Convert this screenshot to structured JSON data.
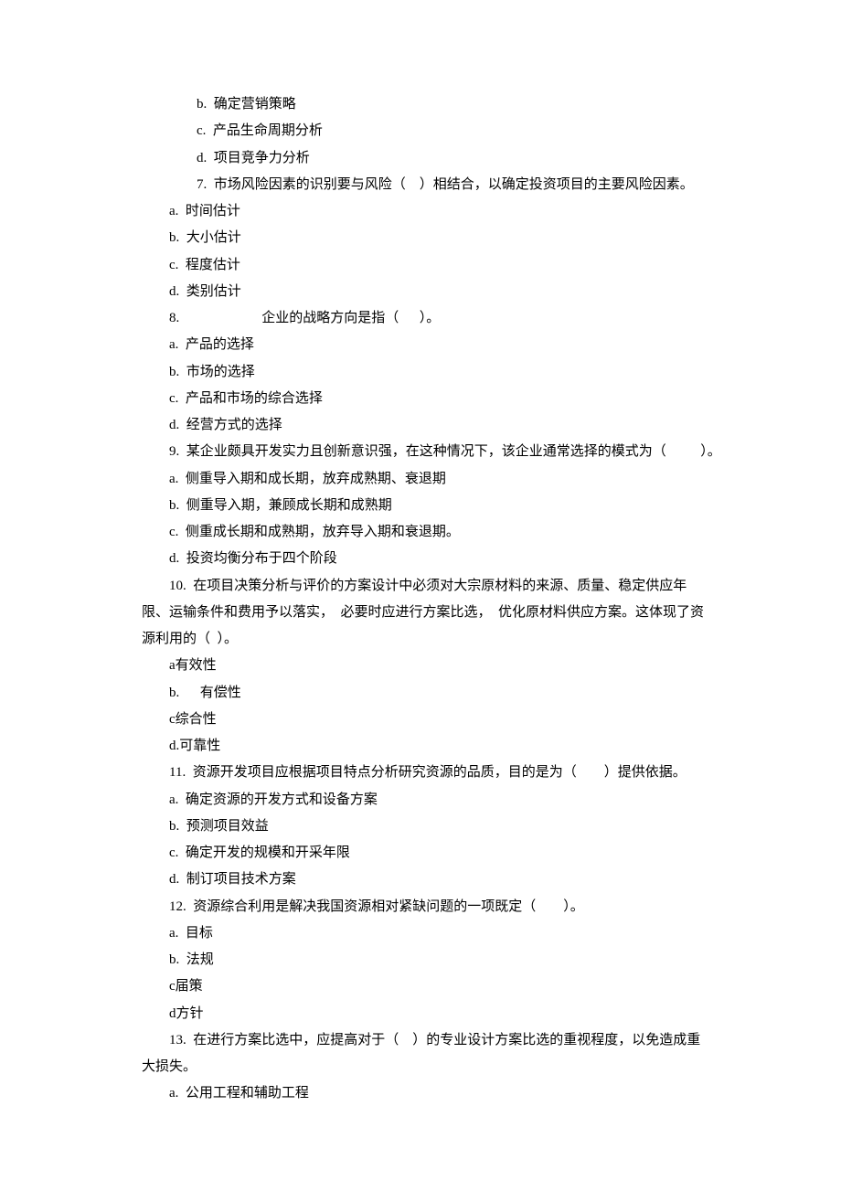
{
  "lines": [
    {
      "ind": 2,
      "name": "q-prev-option-b",
      "text": "b.  确定营销策略"
    },
    {
      "ind": 2,
      "name": "q-prev-option-c",
      "text": "c.  产品生命周期分析"
    },
    {
      "ind": 2,
      "name": "q-prev-option-d",
      "text": "d.  项目竞争力分析"
    },
    {
      "ind": 2,
      "name": "q7-stem",
      "text": "7.  市场风险因素的识别要与风险（    ）相结合，以确定投资项目的主要风险因素。"
    },
    {
      "ind": 1,
      "name": "q7-option-a",
      "text": "a.  时间估计"
    },
    {
      "ind": 1,
      "name": "q7-option-b",
      "text": "b.  大小估计"
    },
    {
      "ind": 1,
      "name": "q7-option-c",
      "text": "c.  程度估计"
    },
    {
      "ind": 1,
      "name": "q7-option-d",
      "text": "d.  类别估计"
    },
    {
      "ind": 1,
      "name": "q8-stem",
      "text": "8.                        企业的战略方向是指（      ）。"
    },
    {
      "ind": 1,
      "name": "q8-option-a",
      "text": "a.  产品的选择"
    },
    {
      "ind": 1,
      "name": "q8-option-b",
      "text": "b.  市场的选择"
    },
    {
      "ind": 1,
      "name": "q8-option-c",
      "text": "c.  产品和市场的综合选择"
    },
    {
      "ind": 1,
      "name": "q8-option-d",
      "text": "d.  经营方式的选择"
    },
    {
      "ind": 1,
      "name": "q9-stem",
      "text": "9.  某企业颇具开发实力且创新意识强，在这种情况下，该企业通常选择的模式为（          ）。"
    },
    {
      "ind": 1,
      "name": "q9-option-a",
      "text": "a.  侧重导入期和成长期，放弃成熟期、衰退期"
    },
    {
      "ind": 1,
      "name": "q9-option-b",
      "text": "b.  侧重导入期，兼顾成长期和成熟期"
    },
    {
      "ind": 1,
      "name": "q9-option-c",
      "text": "c.  侧重成长期和成熟期，放弃导入期和衰退期。"
    },
    {
      "ind": 1,
      "name": "q9-option-d",
      "text": "d.  投资均衡分布于四个阶段"
    },
    {
      "ind": 1,
      "name": "q10-stem-l1",
      "text": "10.  在项目决策分析与评价的方案设计中必须对大宗原材料的来源、质量、稳定供应年"
    },
    {
      "ind": 0,
      "name": "q10-stem-l2",
      "text": "限、运输条件和费用予以落实，  必要时应进行方案比选，  优化原材料供应方案。这体现了资"
    },
    {
      "ind": 0,
      "name": "q10-stem-l3",
      "text": "源利用的（  ）。"
    },
    {
      "ind": 1,
      "name": "q10-option-a",
      "text": "a有效性"
    },
    {
      "ind": 1,
      "name": "q10-option-b",
      "text": "b.      有偿性"
    },
    {
      "ind": 1,
      "name": "q10-option-c",
      "text": "c综合性"
    },
    {
      "ind": 1,
      "name": "q10-option-d",
      "text": "d.可靠性"
    },
    {
      "ind": 1,
      "name": "q11-stem",
      "text": "11.  资源开发项目应根据项目特点分析研究资源的品质，目的是为（        ）提供依据。"
    },
    {
      "ind": 1,
      "name": "q11-option-a",
      "text": "a.  确定资源的开发方式和设备方案"
    },
    {
      "ind": 1,
      "name": "q11-option-b",
      "text": "b.  预测项目效益"
    },
    {
      "ind": 1,
      "name": "q11-option-c",
      "text": "c.  确定开发的规模和开采年限"
    },
    {
      "ind": 1,
      "name": "q11-option-d",
      "text": "d.  制订项目技术方案"
    },
    {
      "ind": 1,
      "name": "q12-stem",
      "text": "12.  资源综合利用是解决我国资源相对紧缺问题的一项既定（        ）。"
    },
    {
      "ind": 1,
      "name": "q12-option-a",
      "text": "a.  目标"
    },
    {
      "ind": 1,
      "name": "q12-option-b",
      "text": "b.  法规"
    },
    {
      "ind": 1,
      "name": "q12-option-c",
      "text": "c届策"
    },
    {
      "ind": 1,
      "name": "q12-option-d",
      "text": "d方针"
    },
    {
      "ind": 1,
      "name": "q13-stem-l1",
      "text": "13.  在进行方案比选中，应提高对于（    ）的专业设计方案比选的重视程度，以免造成重"
    },
    {
      "ind": 0,
      "name": "q13-stem-l2",
      "text": "大损失。"
    },
    {
      "ind": 1,
      "name": "q13-option-a",
      "text": "a.  公用工程和辅助工程"
    }
  ]
}
